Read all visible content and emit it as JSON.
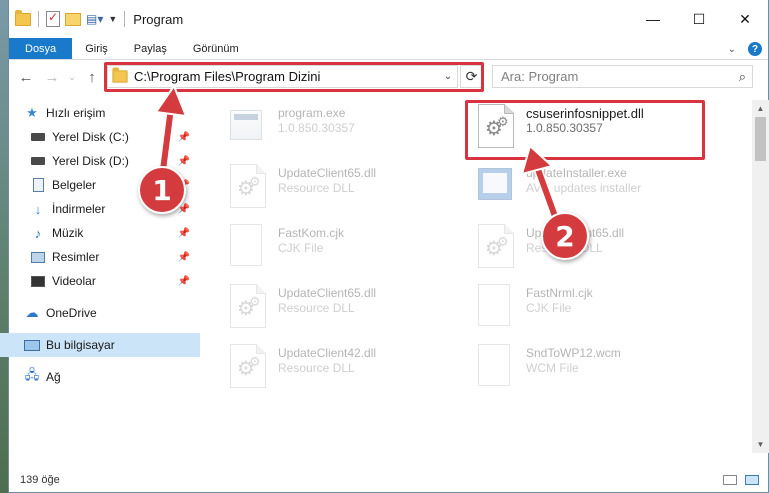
{
  "window": {
    "title": "Program",
    "controls": {
      "minimize": "—",
      "maximize": "☐",
      "close": "✕"
    }
  },
  "ribbon": {
    "tabs": [
      "Dosya",
      "Giriş",
      "Paylaş",
      "Görünüm"
    ]
  },
  "navigation": {
    "address": "C:\\Program Files\\Program Dizini",
    "search_placeholder": "Ara: Program"
  },
  "sidebar": {
    "quick_access": "Hızlı erişim",
    "items": [
      {
        "label": "Yerel Disk (C:)",
        "icon": "disk-icon",
        "pinned": true
      },
      {
        "label": "Yerel Disk (D:)",
        "icon": "disk-icon",
        "pinned": true
      },
      {
        "label": "Belgeler",
        "icon": "documents-icon",
        "pinned": true
      },
      {
        "label": "İndirmeler",
        "icon": "downloads-icon",
        "pinned": true
      },
      {
        "label": "Müzik",
        "icon": "music-icon",
        "pinned": true
      },
      {
        "label": "Resimler",
        "icon": "pictures-icon",
        "pinned": true
      },
      {
        "label": "Videolar",
        "icon": "videos-icon",
        "pinned": true
      }
    ],
    "onedrive": "OneDrive",
    "this_pc": "Bu bilgisayar",
    "network": "Ağ"
  },
  "files": [
    {
      "name": "program.exe",
      "sub": "1.0.850.30357",
      "icon": "exe-icon",
      "faded": true
    },
    {
      "name": "csuserinfosnippet.dll",
      "sub": "1.0.850.30357",
      "icon": "dll-icon",
      "faded": false,
      "highlighted": true
    },
    {
      "name": "UpdateClient65.dll",
      "sub": "Resource DLL",
      "icon": "dll-icon",
      "faded": true
    },
    {
      "name": "updateInstaller.exe",
      "sub": "AVG updates installer",
      "icon": "installer-icon",
      "faded": true
    },
    {
      "name": "FastKom.cjk",
      "sub": "CJK File",
      "icon": "file-icon",
      "faded": true
    },
    {
      "name": "UpdateClient65.dll",
      "sub": "Resource DLL",
      "icon": "dll-icon",
      "faded": true
    },
    {
      "name": "UpdateClient65.dll",
      "sub": "Resource DLL",
      "icon": "dll-icon",
      "faded": true
    },
    {
      "name": "FastNrml.cjk",
      "sub": "CJK File",
      "icon": "file-icon",
      "faded": true
    },
    {
      "name": "UpdateClient42.dll",
      "sub": "Resource DLL",
      "icon": "dll-icon",
      "faded": true
    },
    {
      "name": "SndToWP12.wcm",
      "sub": "WCM File",
      "icon": "file-icon",
      "faded": true
    }
  ],
  "status": {
    "count": "139 öğe"
  },
  "callouts": [
    "1",
    "2"
  ],
  "accent": "#1979ca",
  "highlight_color": "#d9333f"
}
